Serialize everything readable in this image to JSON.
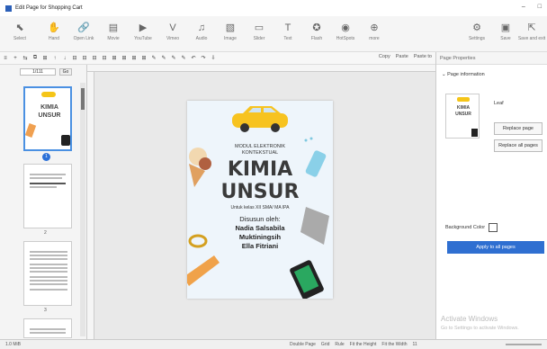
{
  "window": {
    "title": "Edit Page for Shopping Cart",
    "controls": [
      "–",
      "□"
    ]
  },
  "ribbon": {
    "items": [
      {
        "label": "Select",
        "icon": "cursor-icon",
        "glyph": "⬉",
        "active": true
      },
      {
        "label": "Hand",
        "icon": "hand-icon",
        "glyph": "✋",
        "active": false
      },
      {
        "label": "Open Link",
        "icon": "link-icon",
        "glyph": "🔗",
        "active": false
      },
      {
        "label": "Movie",
        "icon": "film-icon",
        "glyph": "▤",
        "active": false
      },
      {
        "label": "YouTube",
        "icon": "youtube-icon",
        "glyph": "▶",
        "active": false
      },
      {
        "label": "Vimeo",
        "icon": "vimeo-icon",
        "glyph": "V",
        "active": false
      },
      {
        "label": "Audio",
        "icon": "music-icon",
        "glyph": "♫",
        "active": false
      },
      {
        "label": "Image",
        "icon": "image-icon",
        "glyph": "▧",
        "active": false
      },
      {
        "label": "Slider",
        "icon": "slider-icon",
        "glyph": "▭",
        "active": false
      },
      {
        "label": "Text",
        "icon": "text-icon",
        "glyph": "T",
        "active": false
      },
      {
        "label": "Flash",
        "icon": "flash-icon",
        "glyph": "✪",
        "active": false
      },
      {
        "label": "HotSpots",
        "icon": "hotspot-icon",
        "glyph": "◉",
        "active": false
      },
      {
        "label": "more",
        "icon": "more-icon",
        "glyph": "⊕",
        "active": false
      },
      {
        "label": "Settings",
        "icon": "gear-icon",
        "glyph": "⚙",
        "active": false
      },
      {
        "label": "Save",
        "icon": "save-icon",
        "glyph": "▣",
        "active": false
      },
      {
        "label": "Save and exit",
        "icon": "save-exit-icon",
        "glyph": "⇱",
        "active": false
      }
    ]
  },
  "toolbar": {
    "icons": [
      "≡",
      "+",
      "⇆",
      "⧉",
      "⊞",
      "↑",
      "↓",
      "⊟",
      "⊟",
      "⊟",
      "⊟",
      "⊞",
      "⊞",
      "⊞",
      "⊞",
      "✎",
      "✎",
      "✎",
      "✎",
      "↶",
      "↷",
      "⇩"
    ],
    "copy_label": "Copy",
    "paste_label": "Paste",
    "paste_to_label": "Paste to"
  },
  "thumbnails": {
    "page_counter": "1/111",
    "go_label": "Go",
    "pages": [
      {
        "number": "1",
        "selected": true
      },
      {
        "number": "2",
        "selected": false
      },
      {
        "number": "3",
        "selected": false
      }
    ]
  },
  "cover": {
    "subtitle1": "MODUL ELEKTRONIK",
    "subtitle2": "KONTEKSTUAL",
    "title1": "KIMIA",
    "title2": "UNSUR",
    "audience": "Untuk kelas XII SMA/ MA IPA",
    "authored": "Disusun oleh:",
    "authors": [
      "Nadia Salsabila",
      "Muktiningsih",
      "Ella Fitriani"
    ]
  },
  "properties": {
    "panel_title": "Page Properties",
    "section": "Page information",
    "label": "Leaf",
    "replace_page": "Replace page",
    "replace_all": "Replace all pages",
    "background_label": "Background Color",
    "apply_label": "Apply to all pages",
    "watermark": "Activate Windows",
    "watermark_sub": "Go to Settings to activate Windows."
  },
  "status": {
    "left": "1.0 MiB",
    "options": [
      "Double Page",
      "Grid",
      "Rule",
      "Fit the Height",
      "Fit the Width",
      "11"
    ]
  },
  "colors": {
    "accent": "#2f6fd1",
    "selected_thumb": "#4a90e2",
    "ribbon_active": "#b7c6d8"
  }
}
